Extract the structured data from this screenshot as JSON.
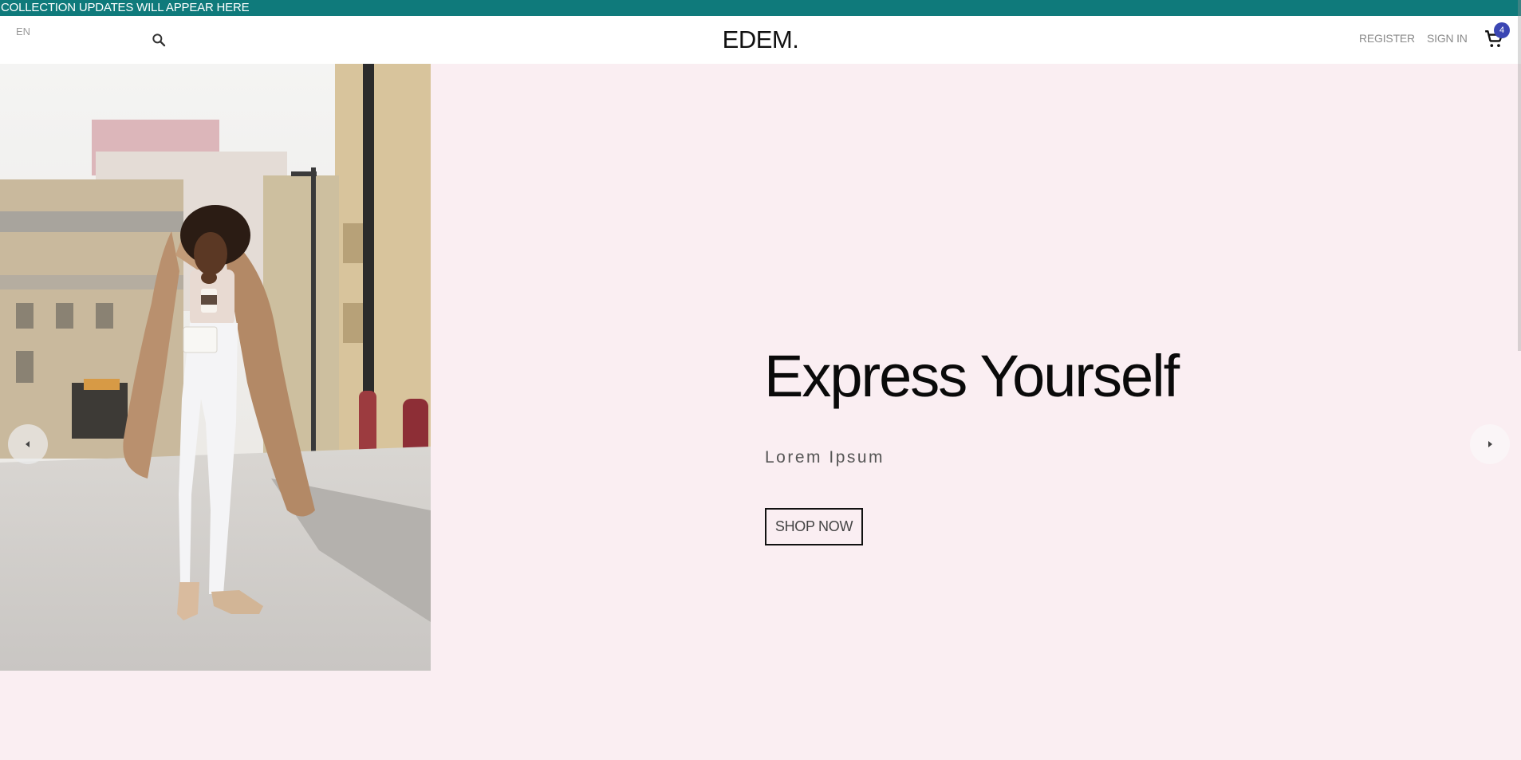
{
  "announcement": {
    "text": "COLLECTION UPDATES WILL APPEAR HERE",
    "bg_color": "#0f7a7b"
  },
  "header": {
    "language": "EN",
    "search_icon": "search-icon",
    "logo": "EDEM.",
    "register_label": "REGISTER",
    "signin_label": "SIGN IN",
    "cart_icon": "shopping-cart-icon",
    "cart_count": "4",
    "badge_color": "#3b46b3"
  },
  "hero": {
    "title": "Express Yourself",
    "subtitle": "Lorem Ipsum",
    "cta_label": "SHOP NOW",
    "prev_icon": "chevron-left-icon",
    "next_icon": "chevron-right-icon",
    "bg_color": "#faeef2"
  }
}
